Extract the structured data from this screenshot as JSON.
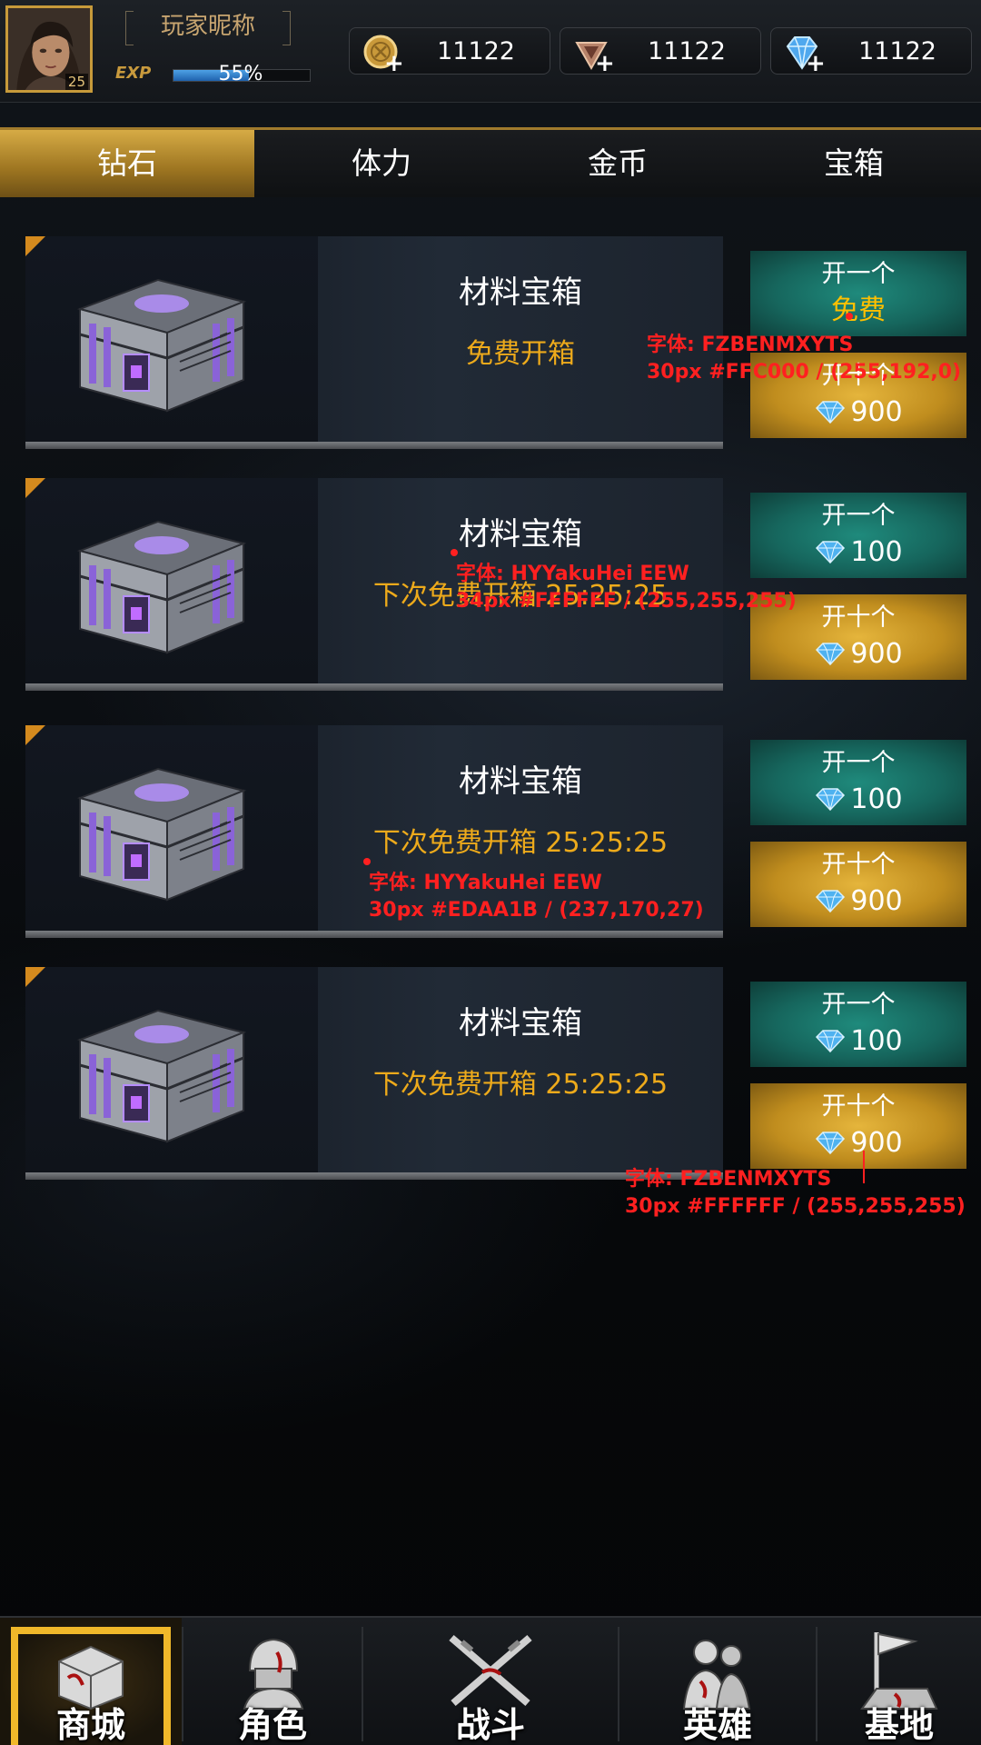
{
  "player": {
    "nickname": "玩家昵称",
    "level": "25",
    "exp_label": "EXP",
    "exp_text": "55%",
    "exp_fraction": 0.55
  },
  "currencies": [
    {
      "name": "gold-coin",
      "value": "11122"
    },
    {
      "name": "stamina-crystal",
      "value": "11122"
    },
    {
      "name": "diamond",
      "value": "11122"
    }
  ],
  "tabs": [
    {
      "label": "钻石",
      "active": true
    },
    {
      "label": "体力",
      "active": false
    },
    {
      "label": "金币",
      "active": false
    },
    {
      "label": "宝箱",
      "active": false
    }
  ],
  "chests": [
    {
      "name": "材料宝箱",
      "status": "免费开箱",
      "buttons": [
        {
          "label": "开一个",
          "price": "免费",
          "style": "green",
          "free": true
        },
        {
          "label": "开十个",
          "price": "900",
          "style": "gold",
          "free": false
        }
      ]
    },
    {
      "name": "材料宝箱",
      "status": "下次免费开箱 25:25:25",
      "buttons": [
        {
          "label": "开一个",
          "price": "100",
          "style": "green",
          "free": false
        },
        {
          "label": "开十个",
          "price": "900",
          "style": "gold",
          "free": false
        }
      ]
    },
    {
      "name": "材料宝箱",
      "status": "下次免费开箱 25:25:25",
      "buttons": [
        {
          "label": "开一个",
          "price": "100",
          "style": "green",
          "free": false
        },
        {
          "label": "开十个",
          "price": "900",
          "style": "gold",
          "free": false
        }
      ]
    },
    {
      "name": "材料宝箱",
      "status": "下次免费开箱 25:25:25",
      "buttons": [
        {
          "label": "开一个",
          "price": "100",
          "style": "green",
          "free": false
        },
        {
          "label": "开十个",
          "price": "900",
          "style": "gold",
          "free": false
        }
      ]
    }
  ],
  "annotations": [
    {
      "line1": "字体: FZBENMXYTS",
      "line2": "30px #FFC000 / (255,192,0)"
    },
    {
      "line1": "字体: HYYakuHei EEW",
      "line2": "34px #FFFFFF / (255,255,255)"
    },
    {
      "line1": "字体: HYYakuHei EEW",
      "line2": "30px #EDAA1B / (237,170,27)"
    },
    {
      "line1": "字体: FZBENMXYTS",
      "line2": "30px #FFFFFF / (255,255,255)"
    }
  ],
  "bottom_nav": [
    {
      "label": "商城",
      "icon": "shop-crate-icon",
      "active": true
    },
    {
      "label": "角色",
      "icon": "soldier-helmet-icon",
      "active": false
    },
    {
      "label": "战斗",
      "icon": "crossed-rifles-icon",
      "active": false
    },
    {
      "label": "英雄",
      "icon": "heroes-icon",
      "active": false
    },
    {
      "label": "基地",
      "icon": "base-flag-icon",
      "active": false
    }
  ],
  "colors": {
    "accent_gold": "#c79a3a",
    "status_orange": "#edaa1b",
    "free_yellow": "#ffc000",
    "button_green": "#16665d",
    "button_gold": "#c08d1e",
    "annotation_red": "#ff2020"
  }
}
